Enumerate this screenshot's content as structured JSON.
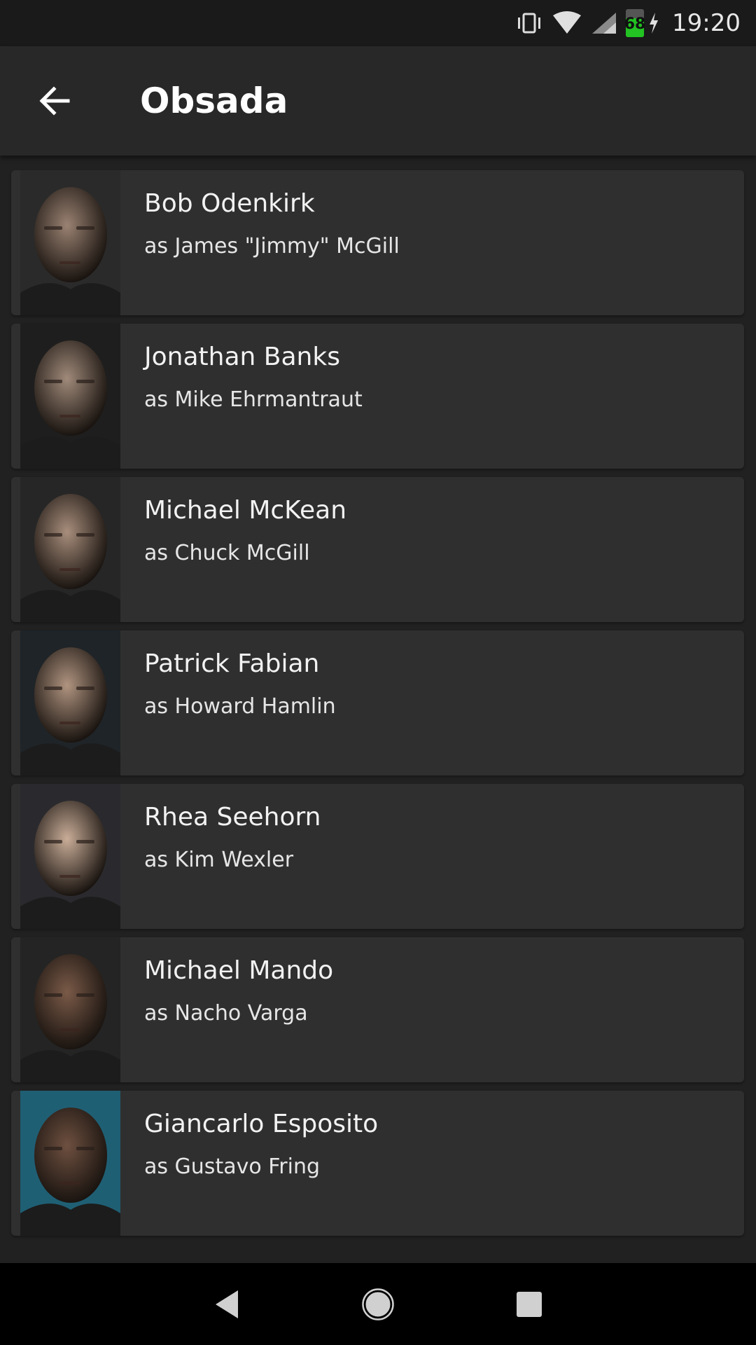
{
  "status_bar": {
    "time": "19:20",
    "battery_level": "68",
    "icons": [
      "vibrate-icon",
      "wifi-icon",
      "cell-signal-icon",
      "battery-icon",
      "charging-icon"
    ],
    "battery_color": "#22c322"
  },
  "app_bar": {
    "title": "Obsada",
    "back_icon": "arrow-back-icon"
  },
  "cast": [
    {
      "name": "Bob Odenkirk",
      "role": "as James \"Jimmy\" McGill",
      "photo_tone": "#9a8272",
      "bg": "#2a2a2a"
    },
    {
      "name": "Jonathan Banks",
      "role": "as Mike Ehrmantraut",
      "photo_tone": "#a08a7a",
      "bg": "#1e1e1e"
    },
    {
      "name": "Michael McKean",
      "role": "as Chuck McGill",
      "photo_tone": "#a88e7c",
      "bg": "#262626"
    },
    {
      "name": "Patrick Fabian",
      "role": "as Howard Hamlin",
      "photo_tone": "#b09480",
      "bg": "#1f2428"
    },
    {
      "name": "Rhea Seehorn",
      "role": "as Kim Wexler",
      "photo_tone": "#c9ad98",
      "bg": "#2a2a2e"
    },
    {
      "name": "Michael Mando",
      "role": "as Nacho Varga",
      "photo_tone": "#7a5a48",
      "bg": "#242424"
    },
    {
      "name": "Giancarlo Esposito",
      "role": "as Gustavo Fring",
      "photo_tone": "#6e5040",
      "bg": "#1f5f74"
    }
  ],
  "nav_bar": {
    "icons": [
      "nav-back-icon",
      "nav-home-icon",
      "nav-recents-icon"
    ]
  }
}
